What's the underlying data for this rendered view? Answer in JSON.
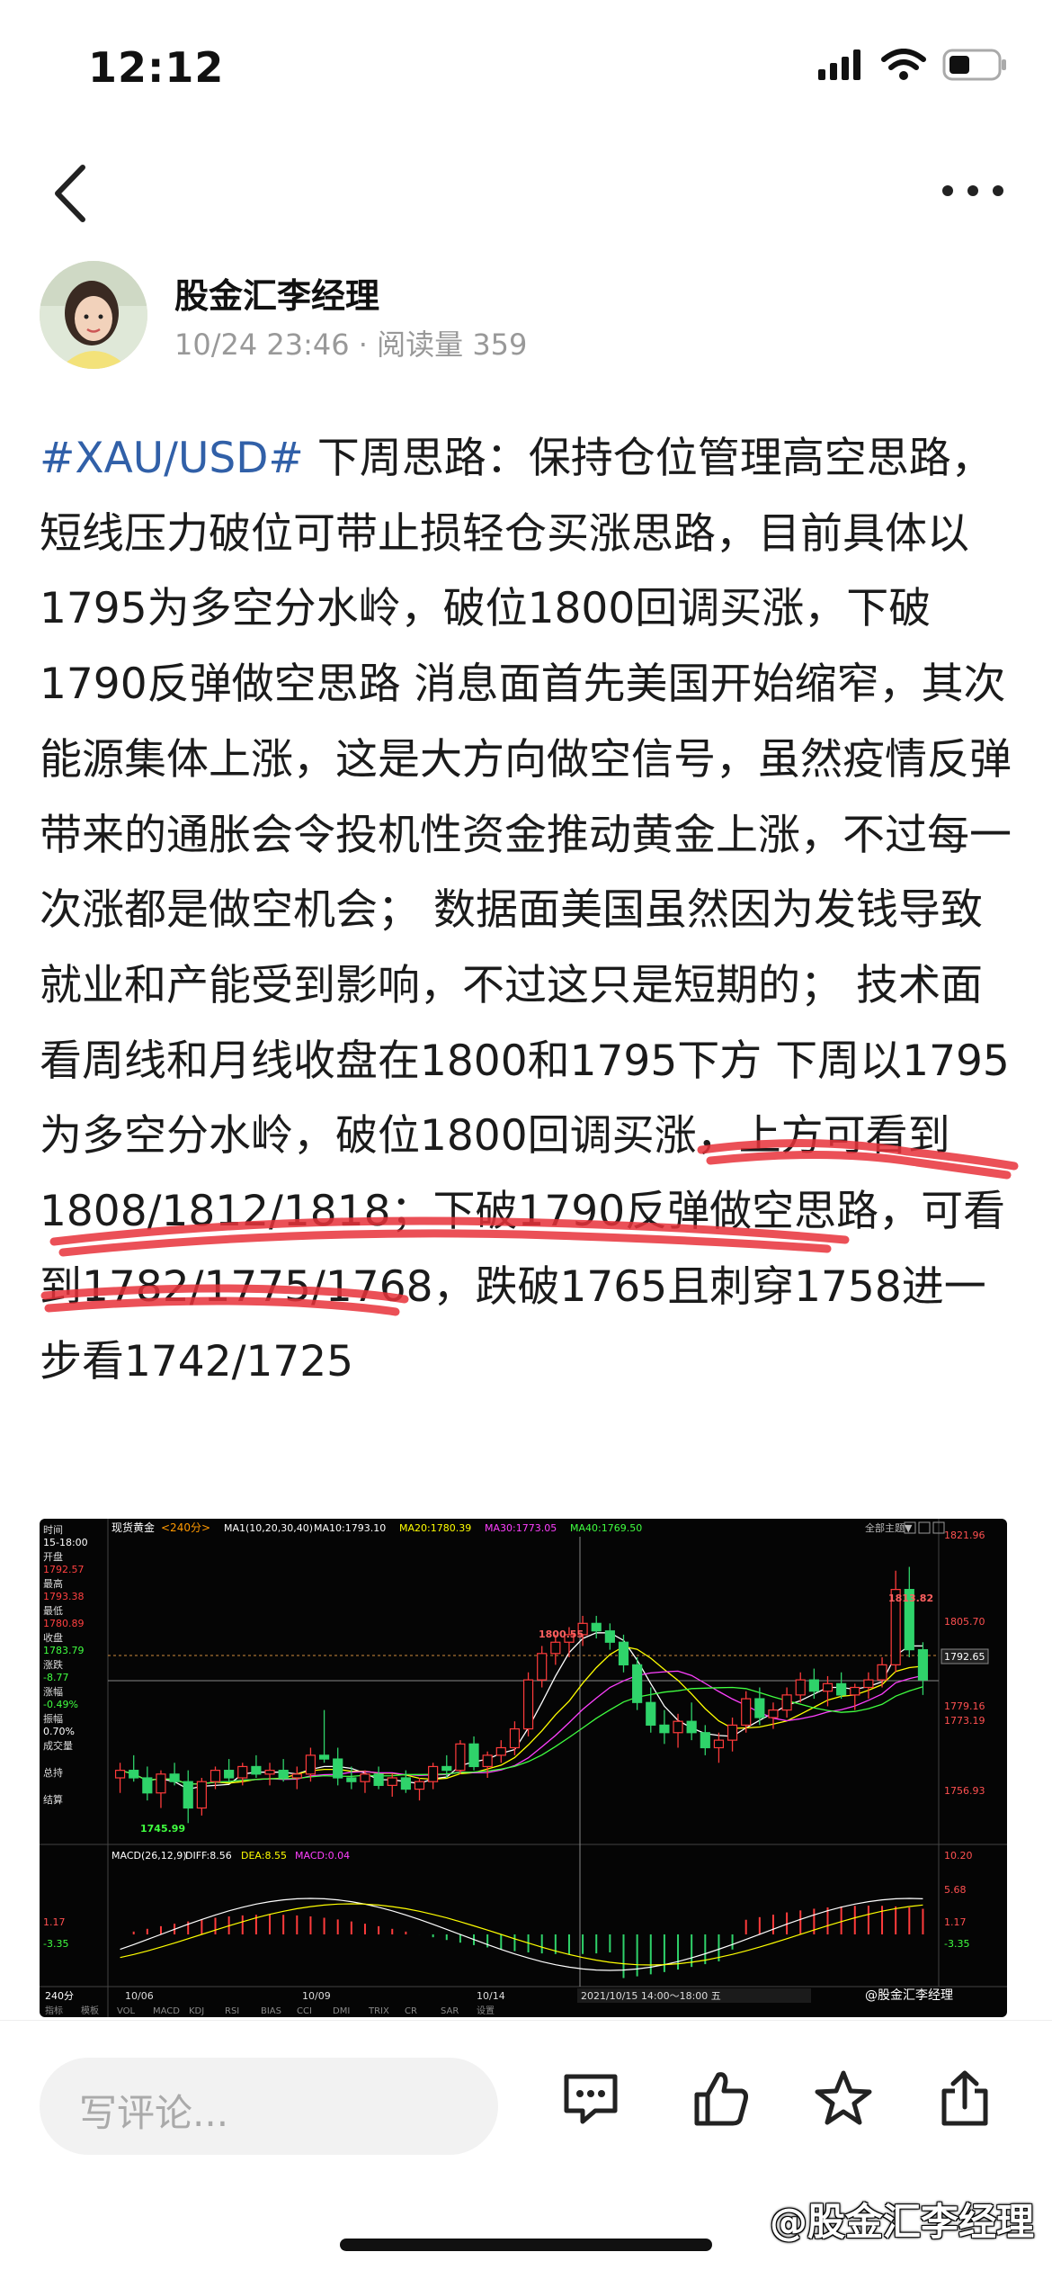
{
  "status_bar": {
    "time": "12:12",
    "icons": [
      "signal-icon",
      "wifi-icon",
      "battery-icon"
    ]
  },
  "nav": {
    "back_icon": "chevron-left-icon",
    "more_icon": "more-dots-icon"
  },
  "author": {
    "name": "股金汇李经理",
    "timestamp": "10/24 23:46",
    "separator": "·",
    "reads_label": "阅读量",
    "reads": "359"
  },
  "post": {
    "hashtag": "#XAU/USD#",
    "body": "下周思路：保持仓位管理高空思路，短线压力破位可带止损轻仓买涨思路，目前具体以1795为多空分水岭，破位1800回调买涨，下破1790反弹做空思路 消息面首先美国开始缩窄，其次能源集体上涨，这是大方向做空信号，虽然疫情反弹带来的通胀会令投机性资金推动黄金上涨，不过每一次涨都是做空机会； 数据面美国虽然因为发钱导致就业和产能受到影响，不过这只是短期的； 技术面看周线和月线收盘在1800和1795下方 下周以1795为多空分水岭，破位1800回调买涨，上方可看到1808/1812/1818；下破1790反弹做空思路，可看到1782/1775/1768，跌破1765且刺穿1758进一步看1742/1725"
  },
  "chart_image": {
    "instrument": "现货黄金",
    "period": "<240分>",
    "ma_legend": [
      "MA1(10,20,30,40)",
      "MA10:1793.10",
      "MA20:1780.39",
      "MA30:1773.05",
      "MA40:1769.50"
    ],
    "ma_colors": [
      "#ffffff",
      "#ffffff",
      "#ffff00",
      "#ff40ff",
      "#40ff40"
    ],
    "top_right": "全部主题▼",
    "left_panel": [
      {
        "label": "时间",
        "value": "15-18:00",
        "value_color": "#ffffff"
      },
      {
        "label": "开盘",
        "value": "1792.57",
        "value_color": "#ff4040"
      },
      {
        "label": "最高",
        "value": "1793.38",
        "value_color": "#ff4040"
      },
      {
        "label": "最低",
        "value": "1780.89",
        "value_color": "#ff4040"
      },
      {
        "label": "收盘",
        "value": "1783.79",
        "value_color": "#40ff40"
      },
      {
        "label": "涨跌",
        "value": "-8.77",
        "value_color": "#40ff40"
      },
      {
        "label": "涨幅",
        "value": "-0.49%",
        "value_color": "#40ff40"
      },
      {
        "label": "振幅",
        "value": "0.70%",
        "value_color": "#ffffff"
      },
      {
        "label": "成交量",
        "value": "",
        "value_color": "#ffffff"
      },
      {
        "label": "总持",
        "value": "",
        "value_color": "#ffffff"
      },
      {
        "label": "结算",
        "value": "",
        "value_color": "#ffffff"
      }
    ],
    "y_labels": [
      "1821.96",
      "1805.70",
      "1792.65",
      "1779.16",
      "1773.19",
      "1756.93"
    ],
    "price_annotations": [
      "1813.82",
      "1800.55",
      "1745.99"
    ],
    "macd_legend": [
      "MACD(26,12,9)",
      "DIFF:8.56",
      "DEA:8.55",
      "MACD:0.04"
    ],
    "macd_left_labels": [
      "1.17",
      "-3.35"
    ],
    "macd_right_labels": [
      "10.20",
      "5.68",
      "1.17",
      "-3.35"
    ],
    "x_labels": [
      "10/06",
      "10/09",
      "10/14"
    ],
    "cursor_label": "2021/10/15 14:00～18:00 五",
    "period_label": "240分",
    "bottom_tabs": [
      "指标",
      "模板",
      "VOL",
      "MACD",
      "KDJ",
      "RSI",
      "BIAS",
      "CCI",
      "DMI",
      "TRIX",
      "CR",
      "SAR",
      "设置"
    ],
    "image_watermark": "@股金汇李经理"
  },
  "bottom_bar": {
    "comment_placeholder": "写评论...",
    "icons": [
      "comment-icon",
      "like-icon",
      "favorite-icon",
      "share-icon"
    ]
  },
  "watermark": "@股金汇李经理"
}
